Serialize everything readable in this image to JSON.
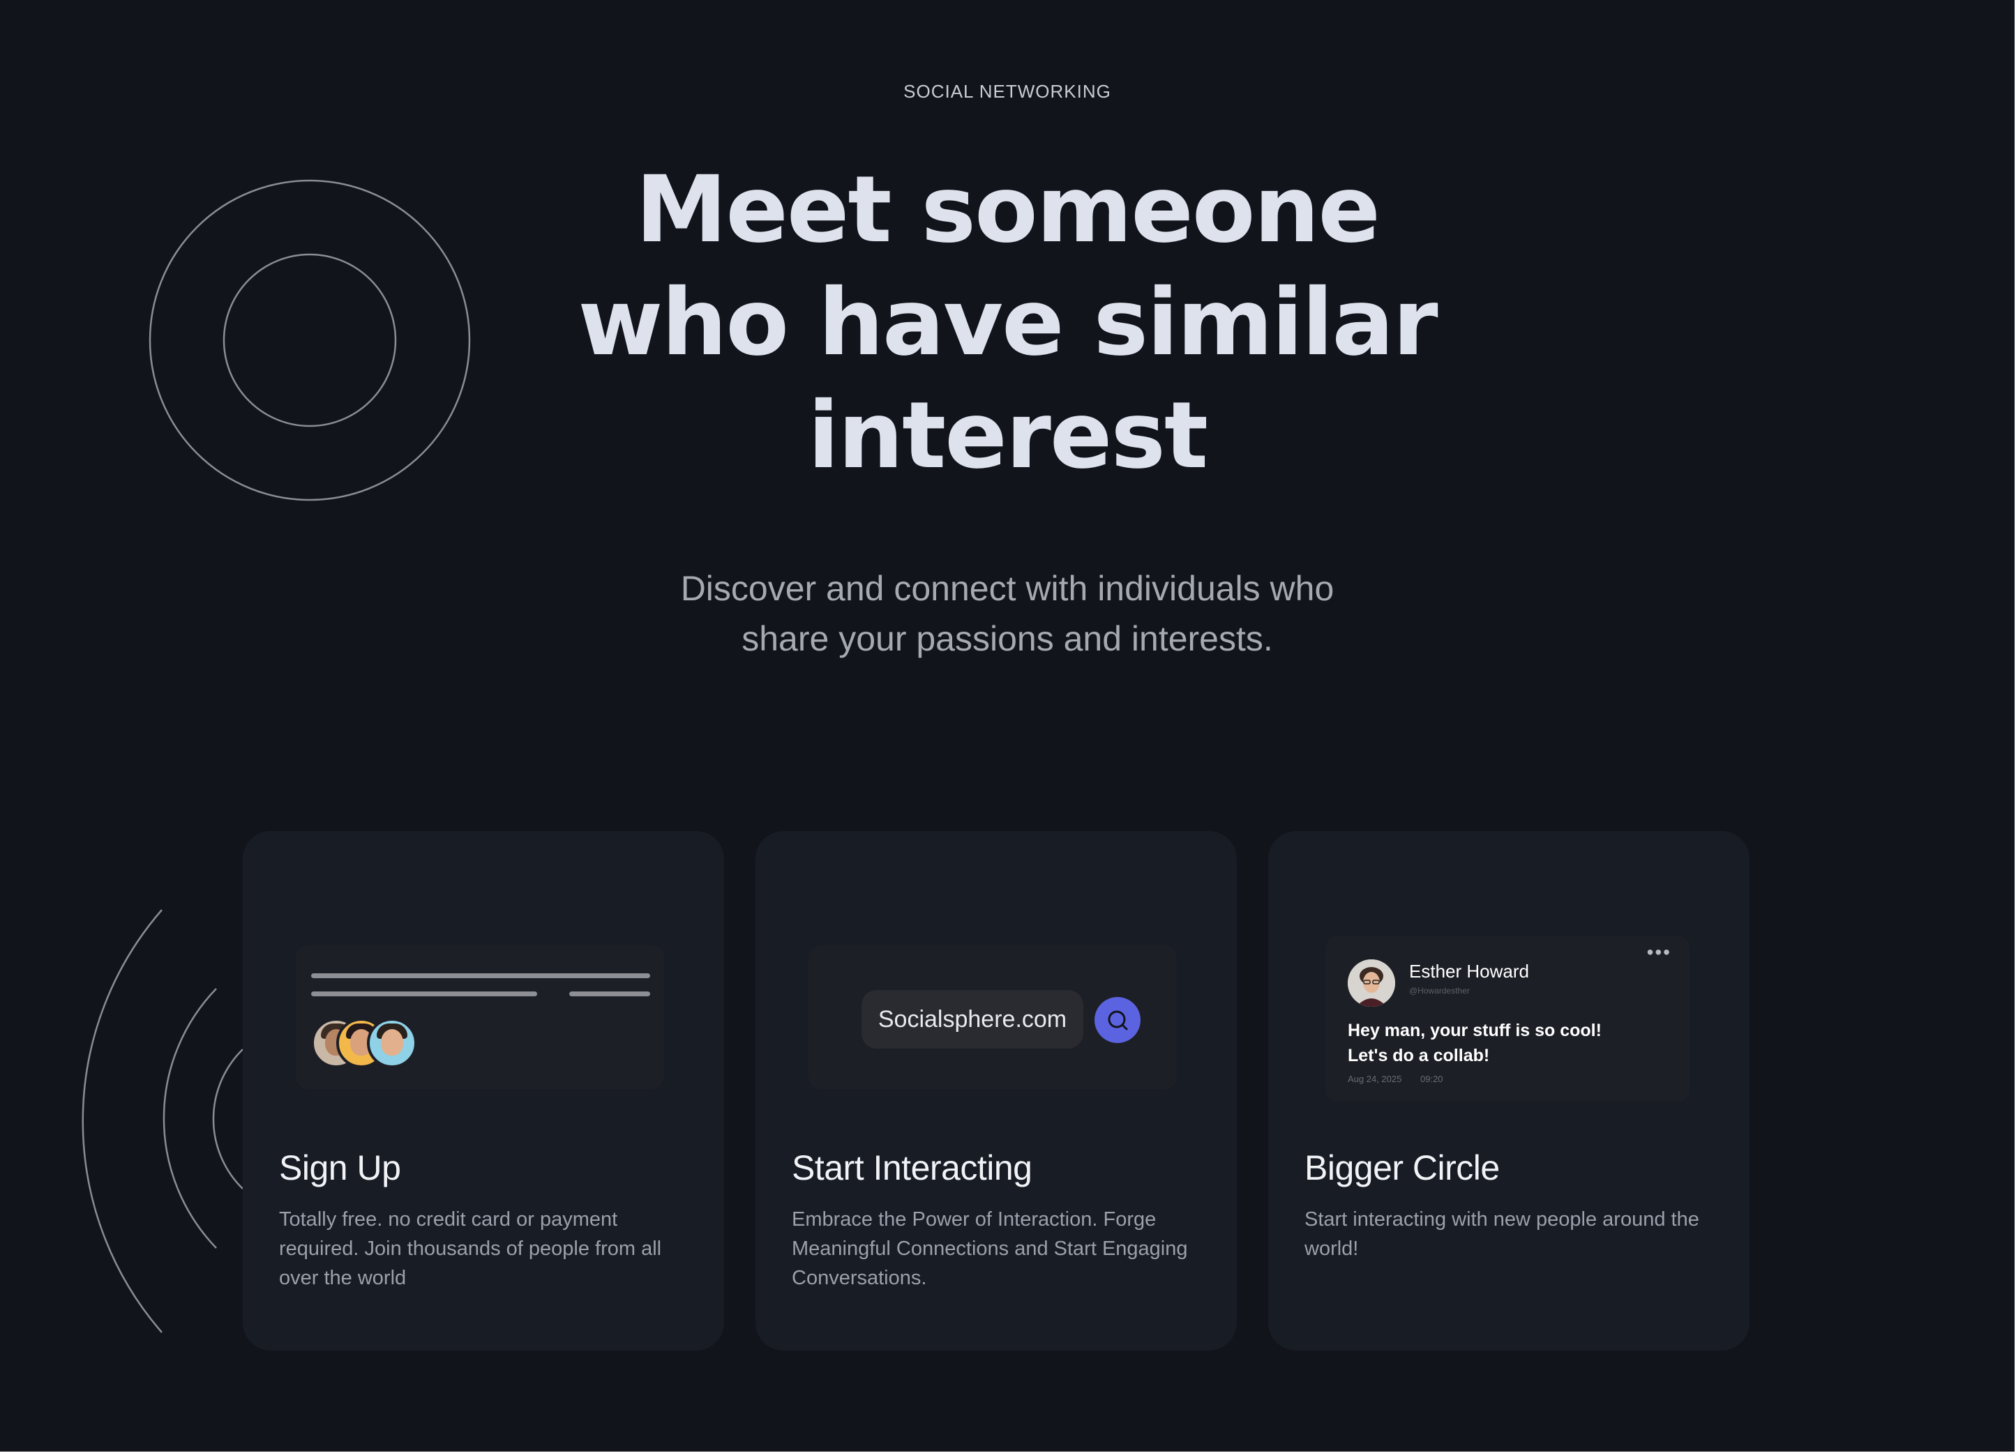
{
  "hero": {
    "eyebrow": "SOCIAL NETWORKING",
    "headline_lines": [
      "Meet someone",
      "who have similar",
      "interest"
    ],
    "subtitle_lines": [
      "Discover and connect with individuals who",
      "share your passions and interests."
    ]
  },
  "cards": [
    {
      "title": "Sign Up",
      "description": "Totally free. no credit card or payment required. Join thousands of people from all over the world",
      "icons": [
        "avatar-stack"
      ]
    },
    {
      "title": "Start Interacting",
      "description": "Embrace the Power of Interaction. Forge Meaningful Connections and Start Engaging Conversations.",
      "search": {
        "value": "Socialsphere.com",
        "button_icon": "search-icon"
      }
    },
    {
      "title": "Bigger Circle",
      "description": "Start interacting with new people around the world!",
      "post": {
        "author": "Esther Howard",
        "handle": "@Howardesther",
        "more": "•••",
        "text_lines": [
          "Hey man, your stuff is so cool!",
          "Let's do a collab!"
        ],
        "date": "Aug 24, 2025",
        "time": "09:20"
      }
    }
  ],
  "colors": {
    "background": "#12141c",
    "card": "#181c24",
    "accent": "#5b63e0",
    "headline": "#dde2ec"
  }
}
